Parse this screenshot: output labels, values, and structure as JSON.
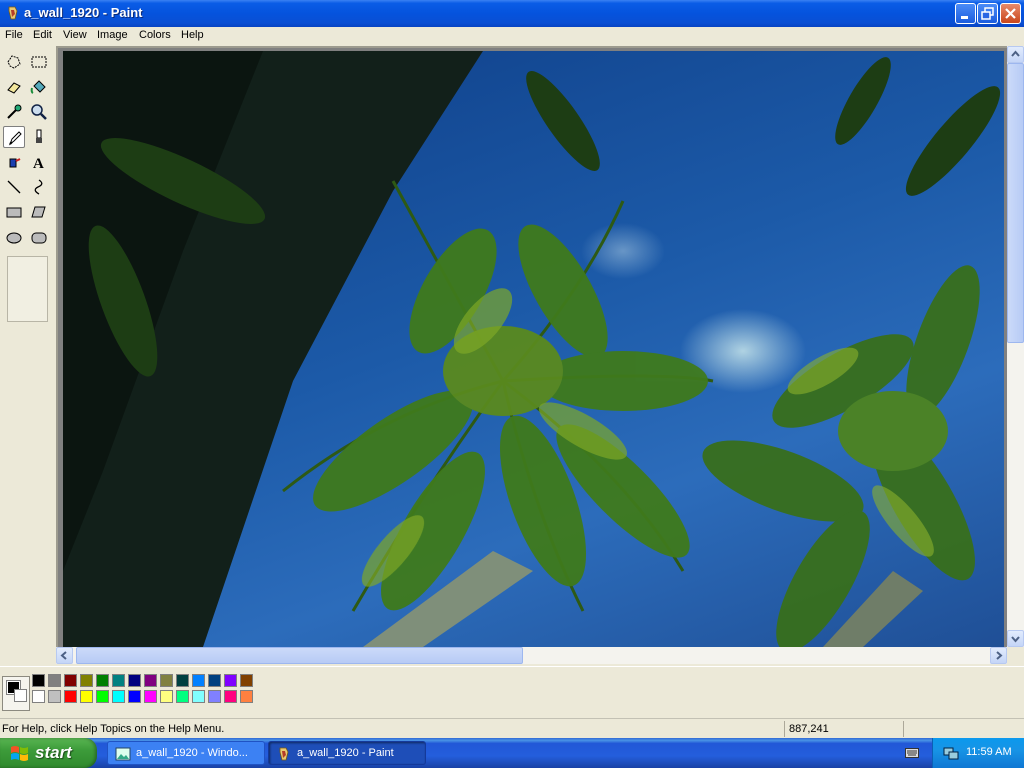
{
  "window": {
    "title": "a_wall_1920 - Paint",
    "buttons": [
      "minimize",
      "maximize",
      "close"
    ]
  },
  "menu": {
    "items": [
      "File",
      "Edit",
      "View",
      "Image",
      "Colors",
      "Help"
    ]
  },
  "toolbox": {
    "tools": [
      {
        "name": "free-form-select",
        "icon": "free-form-select-icon"
      },
      {
        "name": "select",
        "icon": "rectangle-select-icon"
      },
      {
        "name": "eraser",
        "icon": "eraser-icon"
      },
      {
        "name": "fill-with-color",
        "icon": "paint-bucket-icon"
      },
      {
        "name": "pick-color",
        "icon": "eyedropper-icon"
      },
      {
        "name": "magnifier",
        "icon": "magnifier-icon"
      },
      {
        "name": "pencil",
        "icon": "pencil-icon",
        "selected": true
      },
      {
        "name": "brush",
        "icon": "brush-icon"
      },
      {
        "name": "airbrush",
        "icon": "airbrush-icon"
      },
      {
        "name": "text",
        "icon": "text-icon",
        "glyph": "A"
      },
      {
        "name": "line",
        "icon": "line-icon"
      },
      {
        "name": "curve",
        "icon": "curve-icon"
      },
      {
        "name": "rectangle",
        "icon": "rectangle-icon"
      },
      {
        "name": "polygon",
        "icon": "polygon-icon"
      },
      {
        "name": "ellipse",
        "icon": "ellipse-icon"
      },
      {
        "name": "rounded-rectangle",
        "icon": "rounded-rectangle-icon"
      }
    ]
  },
  "palette": {
    "primary": "#000000",
    "secondary": "#ffffff",
    "top_row": [
      "#000000",
      "#808080",
      "#800000",
      "#808000",
      "#008000",
      "#008080",
      "#000080",
      "#800080",
      "#808040",
      "#004040",
      "#0080ff",
      "#004080",
      "#8000ff",
      "#804000"
    ],
    "bottom_row": [
      "#ffffff",
      "#c0c0c0",
      "#ff0000",
      "#ffff00",
      "#00ff00",
      "#00ffff",
      "#0000ff",
      "#ff00ff",
      "#ffff80",
      "#00ff80",
      "#80ffff",
      "#8080ff",
      "#ff0080",
      "#ff8040"
    ]
  },
  "status": {
    "help_text": "For Help, click Help Topics on the Help Menu.",
    "coords": "887,241"
  },
  "taskbar": {
    "start_label": "start",
    "tasks": [
      {
        "label": "a_wall_1920 - Windo...",
        "icon": "picture-viewer-icon",
        "active": false
      },
      {
        "label": "a_wall_1920 - Paint",
        "icon": "paint-icon",
        "active": true
      }
    ],
    "clock": "11:59 AM"
  }
}
